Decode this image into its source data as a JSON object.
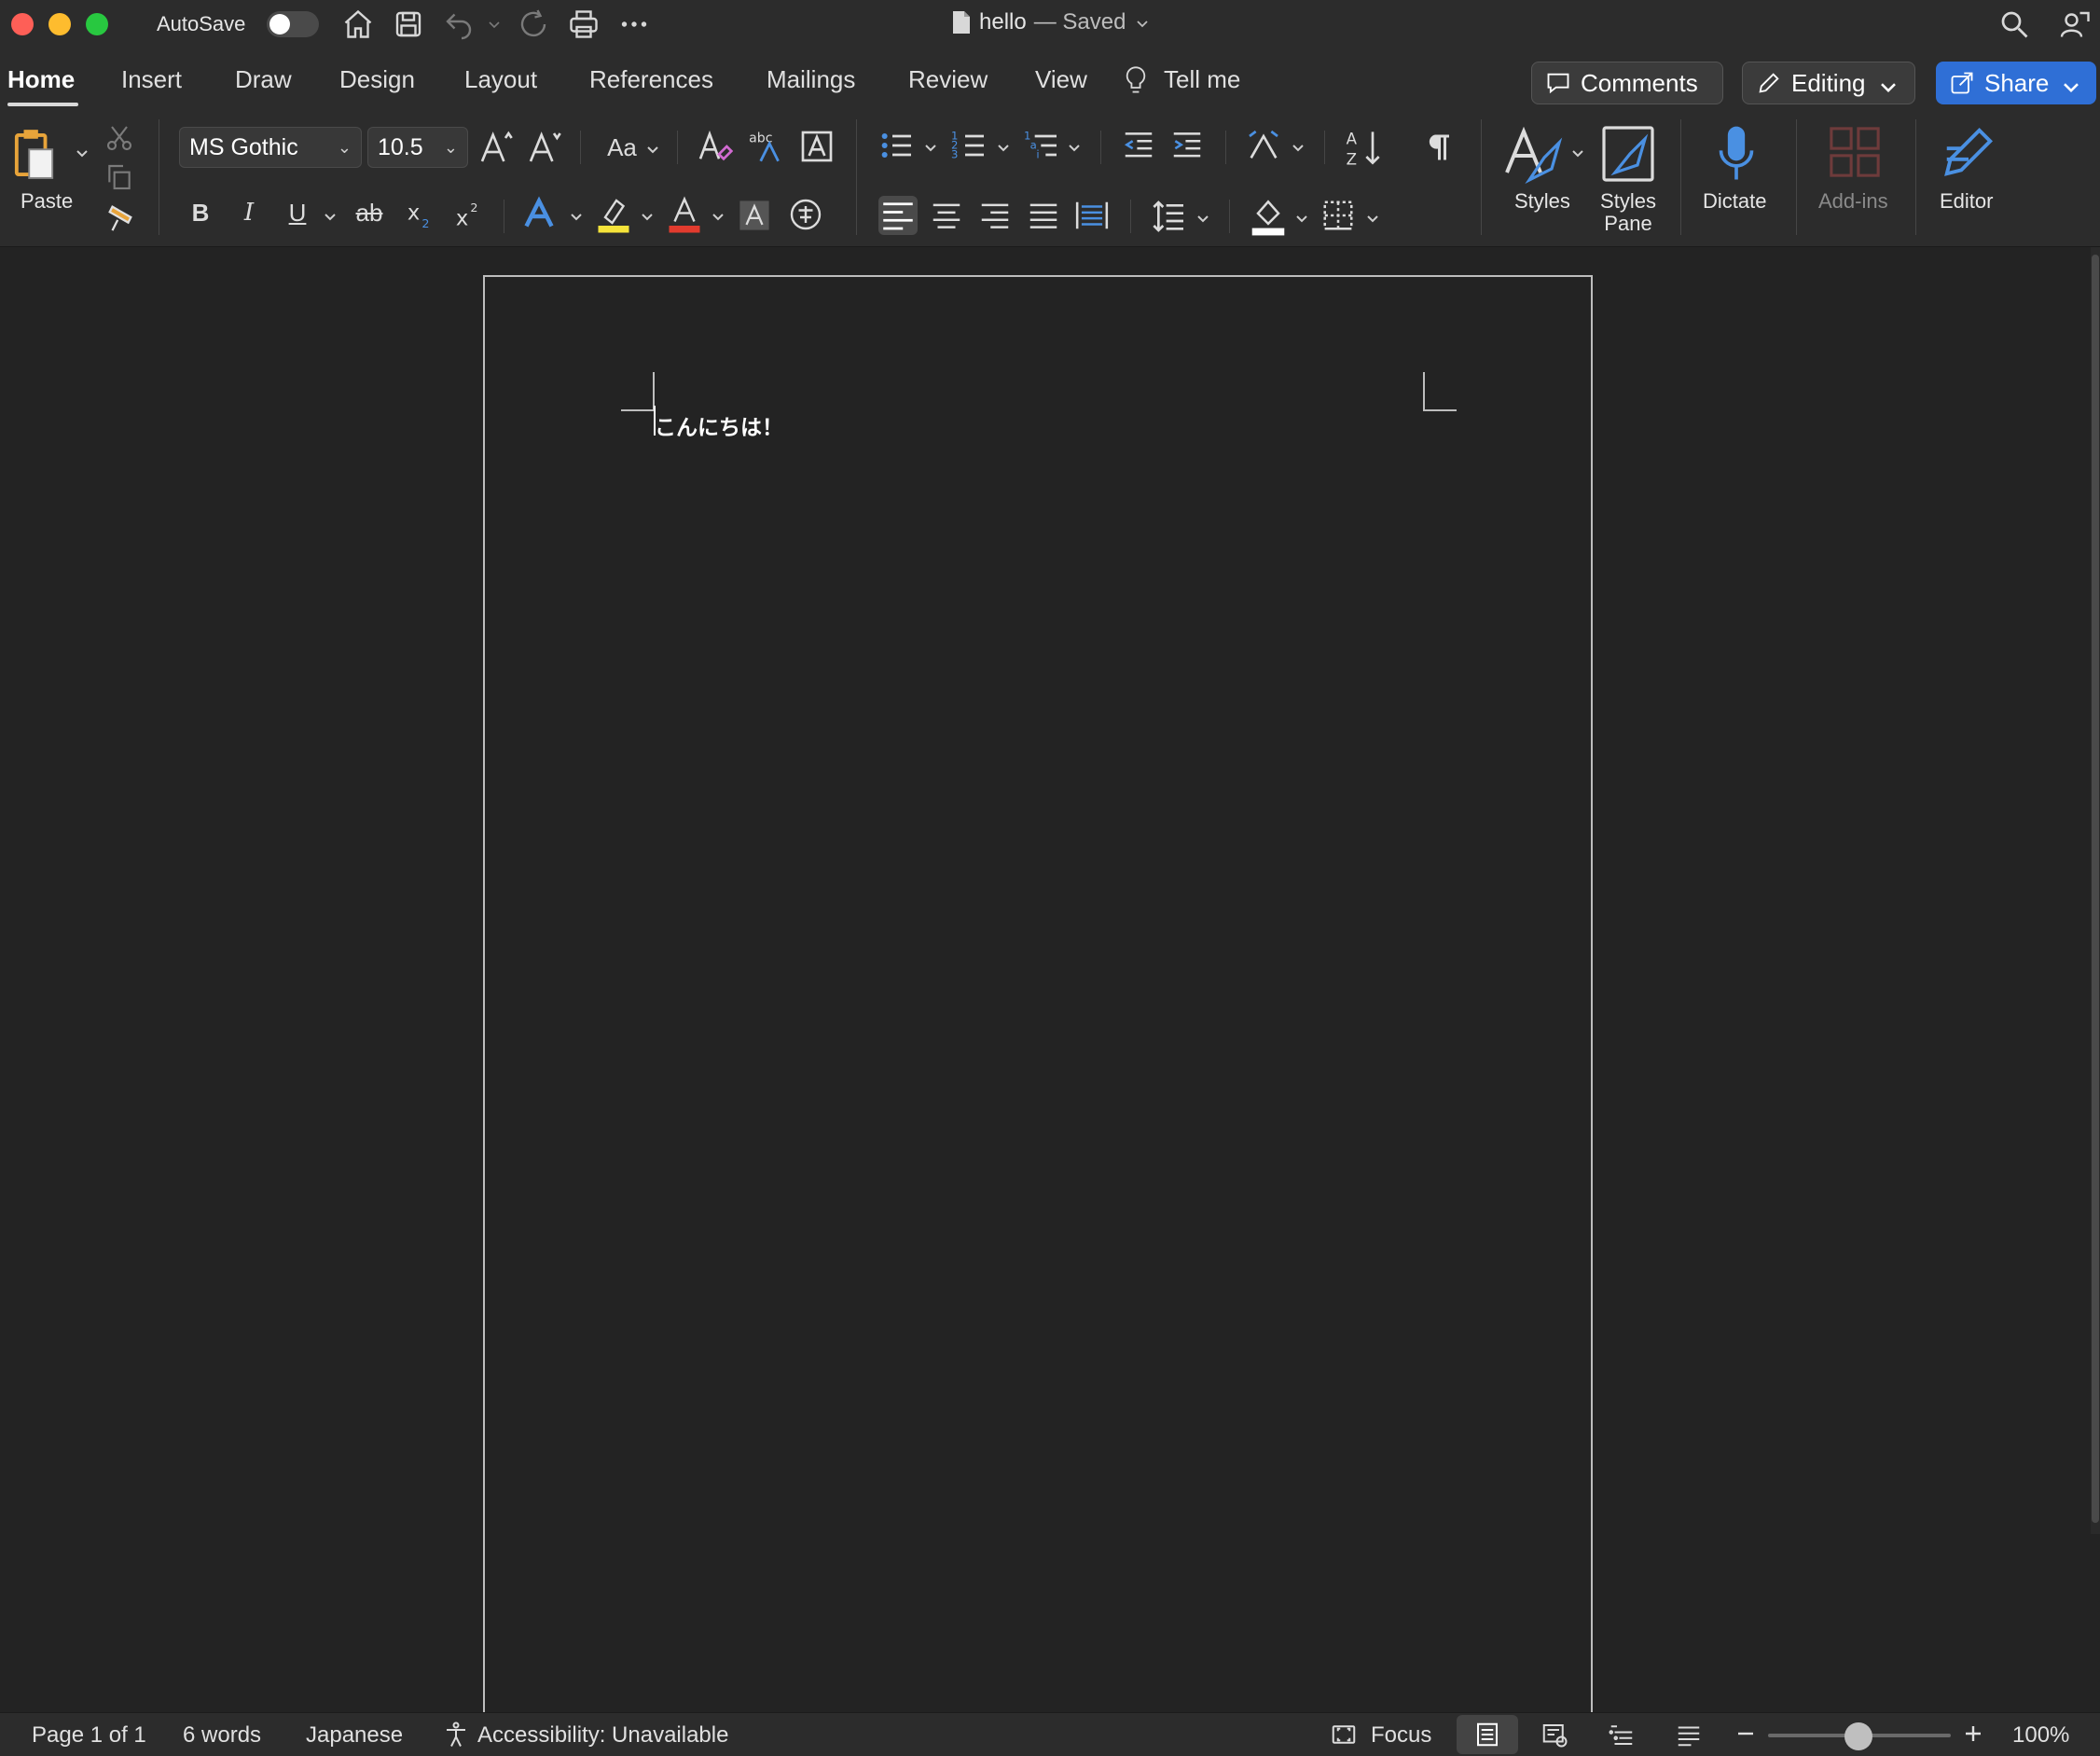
{
  "titlebar": {
    "autosave_label": "AutoSave",
    "document_name": "hello",
    "saved_status": "— Saved"
  },
  "tabs": [
    {
      "label": "Home"
    },
    {
      "label": "Insert"
    },
    {
      "label": "Draw"
    },
    {
      "label": "Design"
    },
    {
      "label": "Layout"
    },
    {
      "label": "References"
    },
    {
      "label": "Mailings"
    },
    {
      "label": "Review"
    },
    {
      "label": "View"
    },
    {
      "label": "Tell me"
    }
  ],
  "actions": {
    "comments_label": "Comments",
    "editing_label": "Editing",
    "share_label": "Share"
  },
  "ribbon": {
    "paste_label": "Paste",
    "font_name": "MS Gothic",
    "font_size": "10.5",
    "styles_label": "Styles",
    "styles_pane_label_1": "Styles",
    "styles_pane_label_2": "Pane",
    "dictate_label": "Dictate",
    "addins_label": "Add-ins",
    "editor_label": "Editor",
    "change_case_label": "Aa",
    "bold_label": "B",
    "italic_label": "I",
    "underline_label": "U",
    "strike_label": "ab",
    "font_color_letter": "A",
    "highlight_color": "#f5e33a",
    "font_color": "#e23b2e",
    "accent_blue": "#2f6fd6"
  },
  "document": {
    "body_text": "こんにちは！"
  },
  "statusbar": {
    "page": "Page 1 of 1",
    "words": "6 words",
    "language": "Japanese",
    "accessibility": "Accessibility: Unavailable",
    "focus": "Focus",
    "zoom": "100%"
  }
}
